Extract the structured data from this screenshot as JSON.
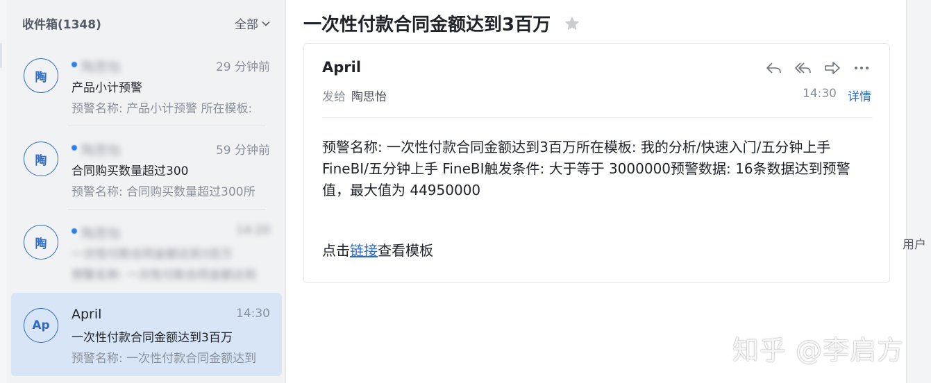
{
  "inbox": {
    "title": "收件箱(1348)",
    "filter_label": "全部",
    "items": [
      {
        "avatar": "陶",
        "sender": "陶思怡",
        "time": "29 分钟前",
        "subject": "产品小计预警",
        "preview": "预警名称: 产品小计预警 所在模板:"
      },
      {
        "avatar": "陶",
        "sender": "陶思怡",
        "time": "59 分钟前",
        "subject": "合同购买数量超过300",
        "preview": "预警名称: 合同购买数量超过300所"
      },
      {
        "avatar": "陶",
        "sender": "陶思怡",
        "time": "14:20",
        "subject": "一次性付款合同金额达到3百万",
        "preview": "预警名称: 一次性付款合同金额达到"
      },
      {
        "avatar": "Ap",
        "sender": "April",
        "time": "14:30",
        "subject": "一次性付款合同金额达到3百万",
        "preview": "预警名称: 一次性付款合同金额达到"
      }
    ]
  },
  "message": {
    "title": "一次性付款合同金额达到3百万",
    "sender": "April",
    "to_label": "发给",
    "to_name": "陶思怡",
    "time": "14:30",
    "details_label": "详情",
    "body": "预警名称: 一次性付款合同金额达到3百万所在模板: 我的分析/快速入门/五分钟上手FineBI/五分钟上手 FineBI触发条件: 大于等于 3000000预警数据: 16条数据达到预警值，最大值为 44950000",
    "link_prefix": "点击",
    "link_text": "链接",
    "link_suffix": "查看模板"
  },
  "gutter_text": "用户",
  "watermark": "知乎 @李启方",
  "colors": {
    "accent": "#2e6bc6",
    "selected_bg": "#d8e5f7",
    "list_bg": "#f1f2f4"
  }
}
